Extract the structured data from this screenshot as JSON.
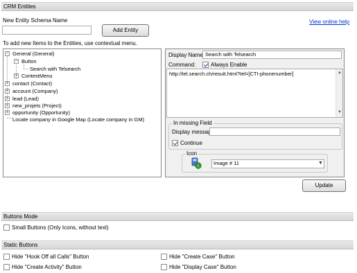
{
  "header": {
    "title": "CRM Entities"
  },
  "new_entity": {
    "label": "New Entity Schema Name",
    "value": "",
    "add_button": "Add Entity",
    "help_link": "View online help",
    "instructions": "To add new Items to the Entities, use contextual menu."
  },
  "tree": {
    "items": [
      "General (General)",
      "Button",
      "Search with Telsearch",
      "ContextMenu",
      "contact (Contact)",
      "account (Company)",
      "lead (Lead)",
      "new_projets (Project)",
      "opportunity (Opportunity)",
      "Locate company in Google Map (Locate company in GM)"
    ]
  },
  "details": {
    "display_name_label": "Display Name:",
    "display_name_value": "Search with Telsearch",
    "command_label": "Command:",
    "always_enable_label": "Always Enable",
    "always_enable_checked": true,
    "command_text": "http://tel.search.ch/result.html?tel=[CTI-phonenumber]",
    "missing_field_title": "In missing Field",
    "display_message_label": "Display message:",
    "display_message_value": "",
    "continue_label": "Continue",
    "continue_checked": true,
    "icon_title": "Icon",
    "icon_select_value": "Image # 11",
    "update_button": "Update"
  },
  "buttons_mode": {
    "title": "Buttons Mode",
    "small_buttons_label": "Small Buttons (Only Icons, without text)"
  },
  "static_buttons": {
    "title": "Static Buttons",
    "hide_hook_off": "Hide \"Hook Off all Calls\" Button",
    "hide_create_case": "Hide \"Create Case\" Button",
    "hide_create_activity": "Hide \"Create Activity\" Button",
    "hide_display_case": "Hide \"Display Case\" Button"
  },
  "colors": {
    "accent": "#0033cc",
    "section_bar": "#dcdcdc",
    "icon_green": "#2e9d2e"
  }
}
